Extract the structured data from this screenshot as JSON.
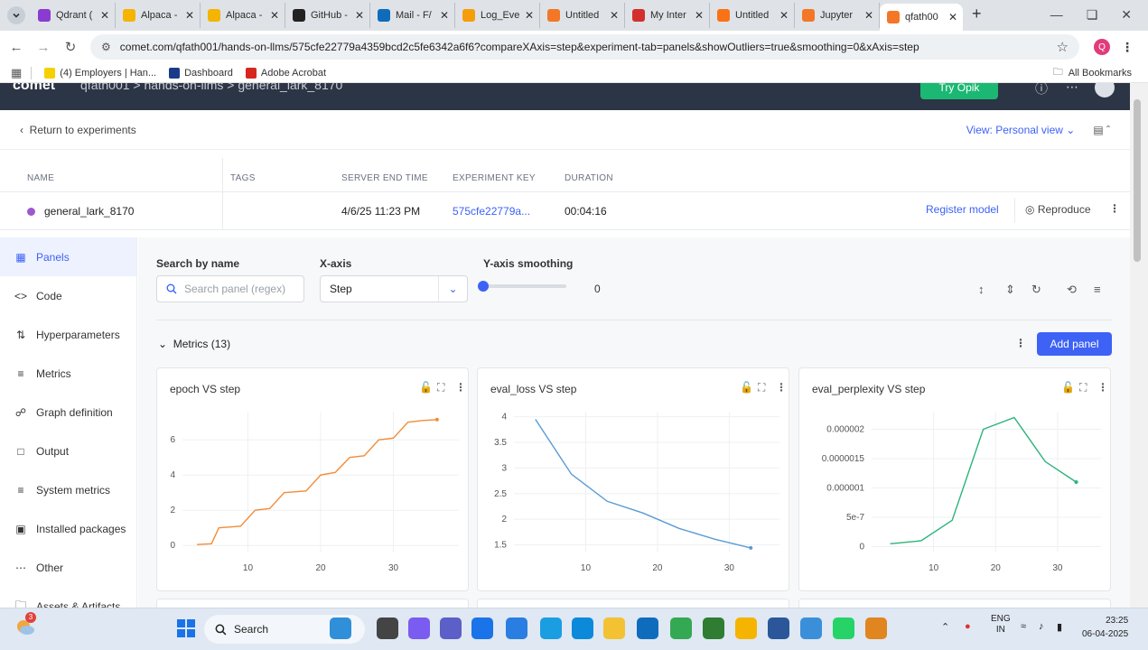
{
  "browser": {
    "tabs": [
      {
        "label": "Qdrant (",
        "color": "#8a3bd1"
      },
      {
        "label": "Alpaca -",
        "color": "#f4b400"
      },
      {
        "label": "Alpaca -",
        "color": "#f4b400"
      },
      {
        "label": "GitHub -",
        "color": "#222222"
      },
      {
        "label": "Mail - F/",
        "color": "#0f6cbd"
      },
      {
        "label": "Log_Eve",
        "color": "#f59e0b"
      },
      {
        "label": "Untitled",
        "color": "#f37726"
      },
      {
        "label": "My Inter",
        "color": "#d32f2f"
      },
      {
        "label": "Untitled",
        "color": "#f97316"
      },
      {
        "label": "Jupyter",
        "color": "#f37726"
      },
      {
        "label": "qfath00",
        "color": "#f37726"
      }
    ],
    "url": "comet.com/qfath001/hands-on-llms/575cfe22779a4359bcd2c5fe6342a6f6?compareXAxis=step&experiment-tab=panels&showOutliers=true&smoothing=0&xAxis=step",
    "profile_initial": "Q"
  },
  "bookmarks": {
    "items": [
      {
        "label": "(4) Employers | Han...",
        "color": "#f6d000"
      },
      {
        "label": "Dashboard",
        "color": "#1b3b8a"
      },
      {
        "label": "Adobe Acrobat",
        "color": "#d7261e"
      }
    ],
    "all_label": "All Bookmarks"
  },
  "app": {
    "logo": "comet",
    "crumbs": "qfath001  >  hands-on-llms  >  general_lark_8170",
    "opik_label": "Try Opik"
  },
  "toolbar": {
    "return_label": "Return to experiments",
    "view_label": "View: Personal view"
  },
  "experiment": {
    "columns": [
      "NAME",
      "TAGS",
      "SERVER END TIME",
      "EXPERIMENT KEY",
      "DURATION"
    ],
    "name": "general_lark_8170",
    "end_time": "4/6/25 11:23 PM",
    "key": "575cfe22779a...",
    "duration": "00:04:16",
    "register_label": "Register model",
    "reproduce_label": "Reproduce"
  },
  "sidebar": {
    "items": [
      {
        "label": "Panels",
        "icon": "grid-icon"
      },
      {
        "label": "Code",
        "icon": "code-icon"
      },
      {
        "label": "Hyperparameters",
        "icon": "sliders-icon"
      },
      {
        "label": "Metrics",
        "icon": "list-icon"
      },
      {
        "label": "Graph definition",
        "icon": "graph-icon"
      },
      {
        "label": "Output",
        "icon": "output-icon"
      },
      {
        "label": "System metrics",
        "icon": "system-icon"
      },
      {
        "label": "Installed packages",
        "icon": "python-icon"
      },
      {
        "label": "Other",
        "icon": "more-icon"
      },
      {
        "label": "Assets & Artifacts",
        "icon": "folder-icon"
      }
    ]
  },
  "filters": {
    "search_label": "Search by name",
    "search_placeholder": "Search panel (regex)",
    "xaxis_label": "X-axis",
    "xaxis_value": "Step",
    "smoothing_label": "Y-axis smoothing",
    "smoothing_value": "0"
  },
  "metrics": {
    "section_label": "Metrics (13)",
    "add_panel_label": "Add panel"
  },
  "chart_data": [
    {
      "type": "line",
      "title": "epoch VS step",
      "color": "#f28c38",
      "x": [
        3,
        5,
        6,
        9,
        11,
        13,
        15,
        18,
        20,
        22,
        24,
        26,
        28,
        30,
        32,
        34,
        36
      ],
      "y": [
        0.05,
        0.1,
        1.0,
        1.1,
        2.0,
        2.1,
        3.0,
        3.1,
        4.0,
        4.15,
        5.0,
        5.1,
        6.0,
        6.1,
        7.0,
        7.1,
        7.15
      ],
      "xticks": [
        "10",
        "20",
        "30"
      ],
      "xtick_values": [
        10,
        20,
        30
      ],
      "yticks": [
        "0",
        "2",
        "4",
        "6"
      ],
      "ytick_values": [
        0,
        2,
        4,
        6
      ],
      "xlim": [
        1,
        39
      ],
      "ylim": [
        -0.4,
        7.6
      ]
    },
    {
      "type": "line",
      "title": "eval_loss VS step",
      "color": "#5b9bd5",
      "x": [
        3,
        8,
        13,
        18,
        23,
        28,
        33
      ],
      "y": [
        3.95,
        2.88,
        2.35,
        2.12,
        1.82,
        1.61,
        1.44
      ],
      "xticks": [
        "10",
        "20",
        "30"
      ],
      "xtick_values": [
        10,
        20,
        30
      ],
      "yticks": [
        "1.5",
        "2",
        "2.5",
        "3",
        "3.5",
        "4"
      ],
      "ytick_values": [
        1.5,
        2,
        2.5,
        3,
        3.5,
        4
      ],
      "xlim": [
        0,
        37
      ],
      "ylim": [
        1.35,
        4.1
      ]
    },
    {
      "type": "line",
      "title": "eval_perplexity VS step",
      "color": "#2bb37b",
      "x": [
        3,
        8,
        13,
        18,
        23,
        28,
        33
      ],
      "y": [
        5e-08,
        1e-07,
        4.5e-07,
        2e-06,
        2.2e-06,
        1.45e-06,
        1.1e-06
      ],
      "xticks": [
        "10",
        "20",
        "30"
      ],
      "xtick_values": [
        10,
        20,
        30
      ],
      "yticks": [
        "0",
        "5e-7",
        "0.000001",
        "0.0000015",
        "0.000002"
      ],
      "ytick_values": [
        0,
        5e-07,
        1e-06,
        1.5e-06,
        2e-06
      ],
      "xlim": [
        0,
        37
      ],
      "ylim": [
        -1e-07,
        2.3e-06
      ]
    }
  ],
  "taskbar": {
    "weather_badge": "3",
    "search_label": "Search",
    "lang_top": "ENG",
    "lang_bottom": "IN",
    "time": "23:25",
    "date": "06-04-2025"
  }
}
